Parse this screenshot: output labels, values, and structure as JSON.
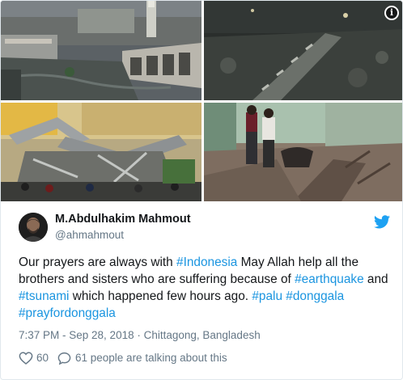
{
  "media": {
    "photos": [
      {
        "icon": "flooded-mosque-photo"
      },
      {
        "icon": "damaged-bridge-night-photo"
      },
      {
        "icon": "collapsed-building-photo"
      },
      {
        "icon": "cracked-road-people-photo"
      }
    ],
    "info_icon": "i"
  },
  "author": {
    "name": "M.Abdulhakim Mahmout",
    "handle": "@ahmahmout"
  },
  "tweet": {
    "segments": [
      {
        "text": "Our prayers are always with ",
        "link": false
      },
      {
        "text": "#Indonesia",
        "link": true
      },
      {
        "text": " May Allah help all the brothers and sisters who are suffering because of ",
        "link": false
      },
      {
        "text": "#earthquake",
        "link": true
      },
      {
        "text": " and ",
        "link": false
      },
      {
        "text": "#tsunami",
        "link": true
      },
      {
        "text": " which happened few hours ago. ",
        "link": false
      },
      {
        "text": "#palu",
        "link": true
      },
      {
        "text": " ",
        "link": false
      },
      {
        "text": "#donggala",
        "link": true
      },
      {
        "text": " ",
        "link": false
      },
      {
        "text": "#prayfordonggala",
        "link": true
      }
    ]
  },
  "meta": {
    "time": "7:37 PM - Sep 28, 2018",
    "separator": " · ",
    "location": "Chittagong, Bangladesh"
  },
  "actions": {
    "likes": "60",
    "talking": "61 people are talking about this"
  },
  "colors": {
    "link": "#1b95e0",
    "muted": "#657786",
    "text": "#14171a",
    "twitter_blue": "#1da1f2"
  }
}
